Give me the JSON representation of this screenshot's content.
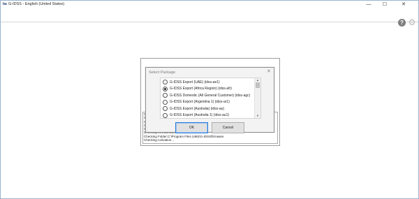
{
  "window": {
    "title": "G-IDSS - English (United States)",
    "icon_text": "ba",
    "minimize_glyph": "—",
    "maximize_glyph": "☐",
    "close_glyph": "✕"
  },
  "header": {
    "help_glyph": "?",
    "settings_glyph": "⚙"
  },
  "dialog": {
    "title": "Select Package",
    "close_glyph": "✕",
    "packages": [
      {
        "label": "G-IDSS Export (UAE) (idss-ae1)",
        "selected": false
      },
      {
        "label": "G-IDSS Export (Africa Region) (idss-afr)",
        "selected": true
      },
      {
        "label": "G-IDSS Domestic (All General Customer) (idss-agc)",
        "selected": false
      },
      {
        "label": "G-IDSS Export (Argentina 1) (idss-ar1)",
        "selected": false
      },
      {
        "label": "G-IDSS Export (Australia) (idss-au)",
        "selected": false
      },
      {
        "label": "G-IDSS Export (Australia 1) (idss-au1)",
        "selected": false
      }
    ],
    "ok_label": "OK",
    "cancel_label": "Cancel"
  },
  "log": {
    "lines": [
      "Che",
      "Che",
      "Che",
      "Che",
      "Che",
      "Checking Remote.Exe",
      "Checking Folder:C:\\Program Files (x86)\\G-IDSS\\firmware",
      "Checking Activation..."
    ]
  },
  "colors": {
    "ok_focus_border": "#2f7bd6",
    "dialog_bg": "#f3f3f3",
    "frame_border": "#9db3cf"
  }
}
